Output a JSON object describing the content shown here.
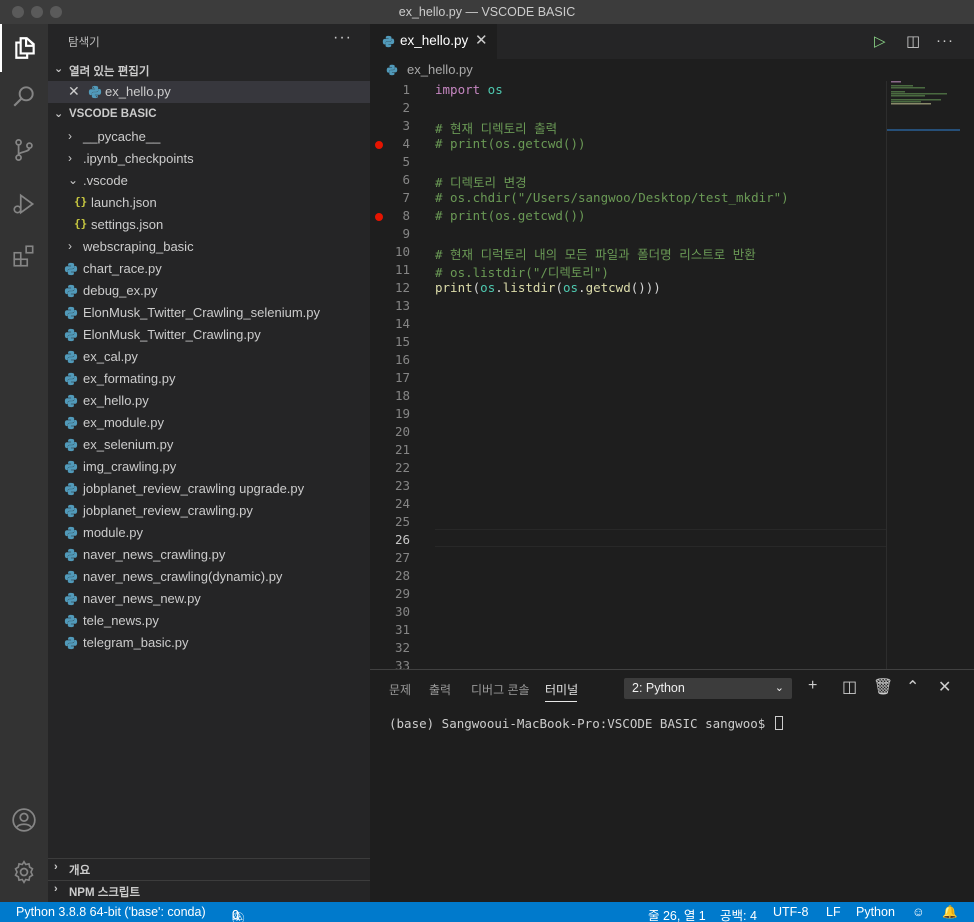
{
  "window": {
    "title": "ex_hello.py — VSCODE BASIC"
  },
  "activity_bar": [
    "files-icon",
    "search-icon",
    "source-control-icon",
    "run-debug-icon",
    "extensions-icon",
    "account-icon",
    "settings-gear-icon"
  ],
  "sidebar": {
    "title": "탐색기",
    "more": "···",
    "open_editors": {
      "header": "열려 있는 편집기",
      "items": [
        {
          "label": "ex_hello.py"
        }
      ]
    },
    "workspace": {
      "header": "VSCODE BASIC",
      "items": [
        {
          "label": "__pycache__",
          "kind": "folder"
        },
        {
          "label": ".ipynb_checkpoints",
          "kind": "folder"
        },
        {
          "label": ".vscode",
          "kind": "folder-open"
        },
        {
          "label": "launch.json",
          "kind": "json"
        },
        {
          "label": "settings.json",
          "kind": "json"
        },
        {
          "label": "webscraping_basic",
          "kind": "folder"
        },
        {
          "label": "chart_race.py",
          "kind": "py"
        },
        {
          "label": "debug_ex.py",
          "kind": "py"
        },
        {
          "label": "ElonMusk_Twitter_Crawling_selenium.py",
          "kind": "py"
        },
        {
          "label": "ElonMusk_Twitter_Crawling.py",
          "kind": "py"
        },
        {
          "label": "ex_cal.py",
          "kind": "py"
        },
        {
          "label": "ex_formating.py",
          "kind": "py"
        },
        {
          "label": "ex_hello.py",
          "kind": "py"
        },
        {
          "label": "ex_module.py",
          "kind": "py"
        },
        {
          "label": "ex_selenium.py",
          "kind": "py"
        },
        {
          "label": "img_crawling.py",
          "kind": "py"
        },
        {
          "label": "jobplanet_review_crawling upgrade.py",
          "kind": "py"
        },
        {
          "label": "jobplanet_review_crawling.py",
          "kind": "py"
        },
        {
          "label": "module.py",
          "kind": "py"
        },
        {
          "label": "naver_news_crawling.py",
          "kind": "py"
        },
        {
          "label": "naver_news_crawling(dynamic).py",
          "kind": "py"
        },
        {
          "label": "naver_news_new.py",
          "kind": "py"
        },
        {
          "label": "tele_news.py",
          "kind": "py"
        },
        {
          "label": "telegram_basic.py",
          "kind": "py"
        }
      ]
    },
    "outline_header": "개요",
    "npm_header": "NPM 스크립트"
  },
  "editor": {
    "tab_label": "ex_hello.py",
    "breadcrumb": "ex_hello.py",
    "line_numbers": [
      "1",
      "2",
      "3",
      "4",
      "5",
      "6",
      "7",
      "8",
      "9",
      "10",
      "11",
      "12",
      "13",
      "14",
      "15",
      "16",
      "17",
      "18",
      "19",
      "20",
      "21",
      "22",
      "23",
      "24",
      "25",
      "26",
      "27",
      "28",
      "29",
      "30",
      "31",
      "32",
      "33"
    ],
    "breakpoint_lines": [
      "4",
      "8"
    ],
    "current_line": "26",
    "code": {
      "l1_kw": "import",
      "l1_mod": " os",
      "l3": "# 현재 디렉토리 출력",
      "l4": "# print(os.getcwd())",
      "l6": "# 디렉토리 변경",
      "l7": "# os.chdir(\"/Users/sangwoo/Desktop/test_mkdir\")",
      "l8": "# print(os.getcwd())",
      "l10": "# 현재 디럭토리 내의 모든 파일과 폴더명 리스트로 반환",
      "l11": "# os.listdir(\"/디렉토리\")",
      "l12_print": "print",
      "l12_p1": "(",
      "l12_os1": "os",
      "l12_dot1": ".",
      "l12_listdir": "listdir",
      "l12_p2": "(",
      "l12_os2": "os",
      "l12_dot2": ".",
      "l12_getcwd": "getcwd",
      "l12_end": "()))"
    }
  },
  "panel": {
    "tabs": [
      "문제",
      "출력",
      "디버그 콘솔",
      "터미널"
    ],
    "active_tab": "터미널",
    "terminal_select": "2: Python",
    "terminal_prompt": "(base) Sangwooui-MacBook-Pro:VSCODE BASIC sangwoo$ "
  },
  "statusbar": {
    "interpreter": "Python 3.8.8 64-bit ('base': conda)",
    "errors": "0",
    "warnings": "0",
    "position": "줄 26, 열 1",
    "spaces": "공백: 4",
    "encoding": "UTF-8",
    "eol": "LF",
    "language": "Python"
  },
  "colors": {
    "accent": "#007acc",
    "breakpoint": "#e51400",
    "keyword": "#c586c0",
    "comment": "#6a9955",
    "function": "#dcdcaa",
    "module": "#4ec9b0"
  }
}
